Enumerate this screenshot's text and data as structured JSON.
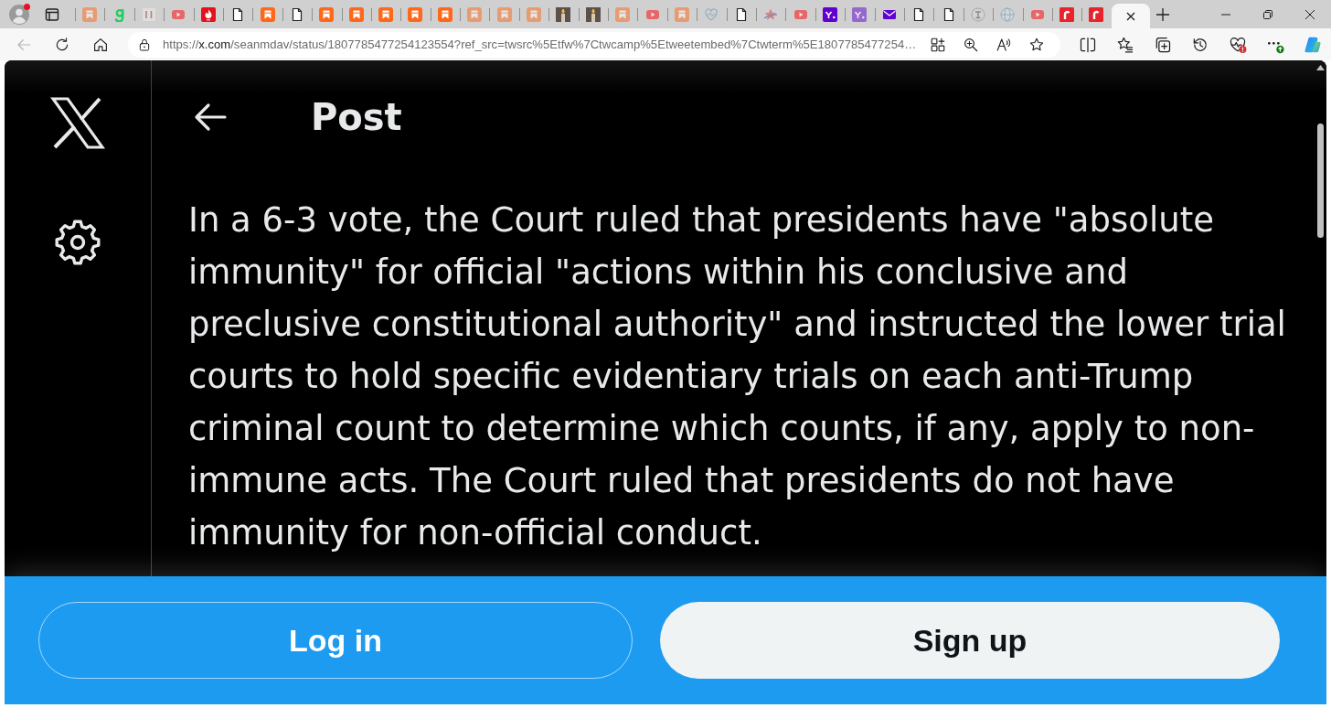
{
  "browser": {
    "profile": {
      "notification": true
    },
    "tabs": [
      {
        "kind": "bookmark",
        "asleep": true,
        "selected": false
      },
      {
        "kind": "gmark",
        "asleep": false,
        "selected": false
      },
      {
        "kind": "serif",
        "asleep": true,
        "selected": false
      },
      {
        "kind": "video",
        "asleep": true,
        "selected": false
      },
      {
        "kind": "flame",
        "asleep": false,
        "selected": false
      },
      {
        "kind": "page",
        "asleep": false,
        "selected": false
      },
      {
        "kind": "bookmark",
        "asleep": false,
        "selected": false
      },
      {
        "kind": "page",
        "asleep": false,
        "selected": false
      },
      {
        "kind": "bookmark",
        "asleep": false,
        "selected": false
      },
      {
        "kind": "bookmark",
        "asleep": false,
        "selected": false
      },
      {
        "kind": "bookmark",
        "asleep": false,
        "selected": false
      },
      {
        "kind": "bookmark",
        "asleep": false,
        "selected": false
      },
      {
        "kind": "bookmark",
        "asleep": false,
        "selected": false
      },
      {
        "kind": "bookmark",
        "asleep": true,
        "selected": false
      },
      {
        "kind": "bookmark",
        "asleep": true,
        "selected": false
      },
      {
        "kind": "bookmark",
        "asleep": true,
        "selected": false
      },
      {
        "kind": "candle",
        "asleep": false,
        "selected": false
      },
      {
        "kind": "candle",
        "asleep": false,
        "selected": false
      },
      {
        "kind": "bookmark",
        "asleep": true,
        "selected": false
      },
      {
        "kind": "video",
        "asleep": true,
        "selected": false
      },
      {
        "kind": "bookmark",
        "asleep": true,
        "selected": false
      },
      {
        "kind": "pulse",
        "asleep": true,
        "selected": false
      },
      {
        "kind": "page",
        "asleep": false,
        "selected": false
      },
      {
        "kind": "star",
        "asleep": true,
        "selected": false
      },
      {
        "kind": "video",
        "asleep": true,
        "selected": false
      },
      {
        "kind": "yahoo",
        "asleep": false,
        "selected": false
      },
      {
        "kind": "yahoo",
        "asleep": true,
        "selected": false
      },
      {
        "kind": "mail",
        "asleep": false,
        "selected": false
      },
      {
        "kind": "page",
        "asleep": false,
        "selected": false
      },
      {
        "kind": "page",
        "asleep": false,
        "selected": false
      },
      {
        "kind": "emblem",
        "asleep": true,
        "selected": false
      },
      {
        "kind": "globe",
        "asleep": true,
        "selected": false
      },
      {
        "kind": "video",
        "asleep": true,
        "selected": false
      },
      {
        "kind": "rtile",
        "asleep": false,
        "selected": false
      },
      {
        "kind": "rtile",
        "asleep": false,
        "selected": false
      },
      {
        "asleep": false,
        "selected": true
      }
    ],
    "back_button": {
      "disabled": true
    },
    "address_bar": {
      "scheme": "https://",
      "host": "x.com",
      "path": "/seanmdav/status/1807785477254123554?ref_src=twsrc%5Etfw%7Ctwcamp%5Etweetembed%7Ctwterm%5E1807785477254…"
    }
  },
  "page": {
    "header": {
      "title": "Post"
    },
    "post": {
      "text": "In a 6-3 vote, the Court ruled that presidents have \"absolute immunity\" for official \"actions within his conclusive and preclusive constitutional authority\" and instructed the lower trial courts to hold specific evidentiary trials on each anti-Trump criminal count to determine which counts, if any, apply to non-immune acts. The Court ruled that presidents do not have immunity for non-official conduct."
    }
  },
  "signup_bar": {
    "buttons": [
      {
        "label": "Log in",
        "kind": "outline"
      },
      {
        "label": "Sign up",
        "kind": "filled"
      }
    ]
  }
}
